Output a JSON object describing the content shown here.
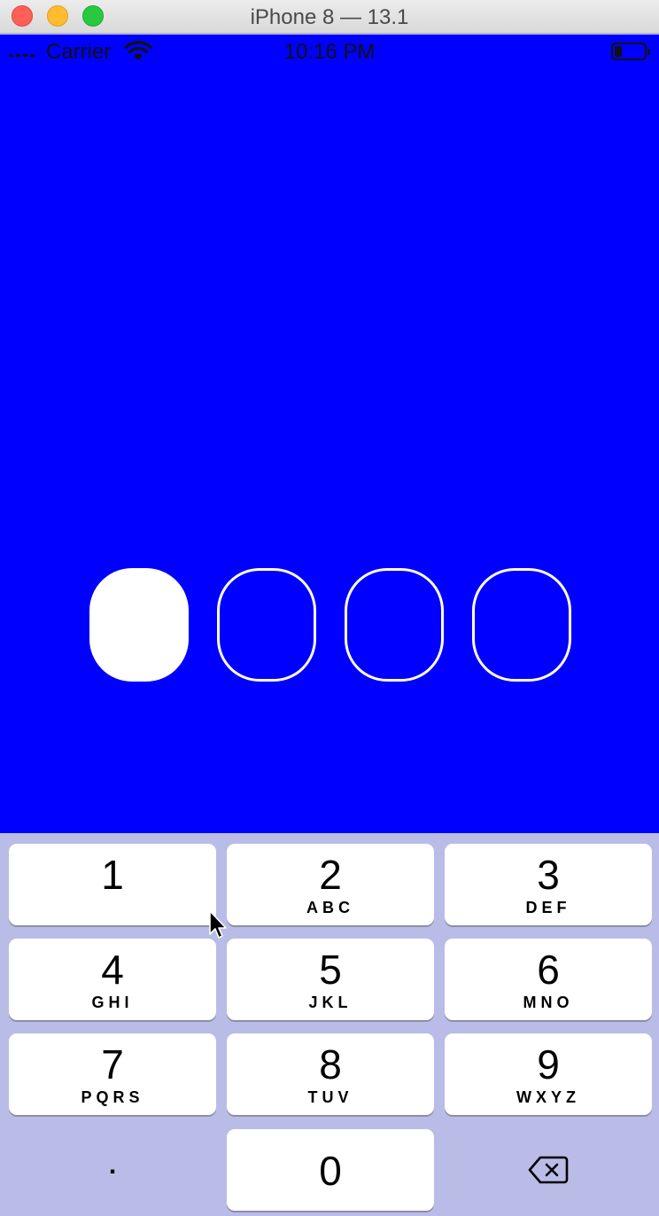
{
  "window": {
    "title": "iPhone 8 — 13.1"
  },
  "status_bar": {
    "carrier": "Carrier",
    "time": "10:16 PM",
    "battery_level": 0.25
  },
  "pin": {
    "length": 4,
    "entered": 1
  },
  "keypad": {
    "keys": [
      {
        "digit": "1",
        "letters": ""
      },
      {
        "digit": "2",
        "letters": "ABC"
      },
      {
        "digit": "3",
        "letters": "DEF"
      },
      {
        "digit": "4",
        "letters": "GHI"
      },
      {
        "digit": "5",
        "letters": "JKL"
      },
      {
        "digit": "6",
        "letters": "MNO"
      },
      {
        "digit": "7",
        "letters": "PQRS"
      },
      {
        "digit": "8",
        "letters": "TUV"
      },
      {
        "digit": "9",
        "letters": "WXYZ"
      }
    ],
    "bottom": {
      "left": ".",
      "zero": "0",
      "delete_icon": "backspace-icon"
    }
  },
  "colors": {
    "background": "#0000ff",
    "pin_stroke": "#ffffff",
    "keypad_background": "#b9bce6",
    "key_background": "#ffffff"
  }
}
